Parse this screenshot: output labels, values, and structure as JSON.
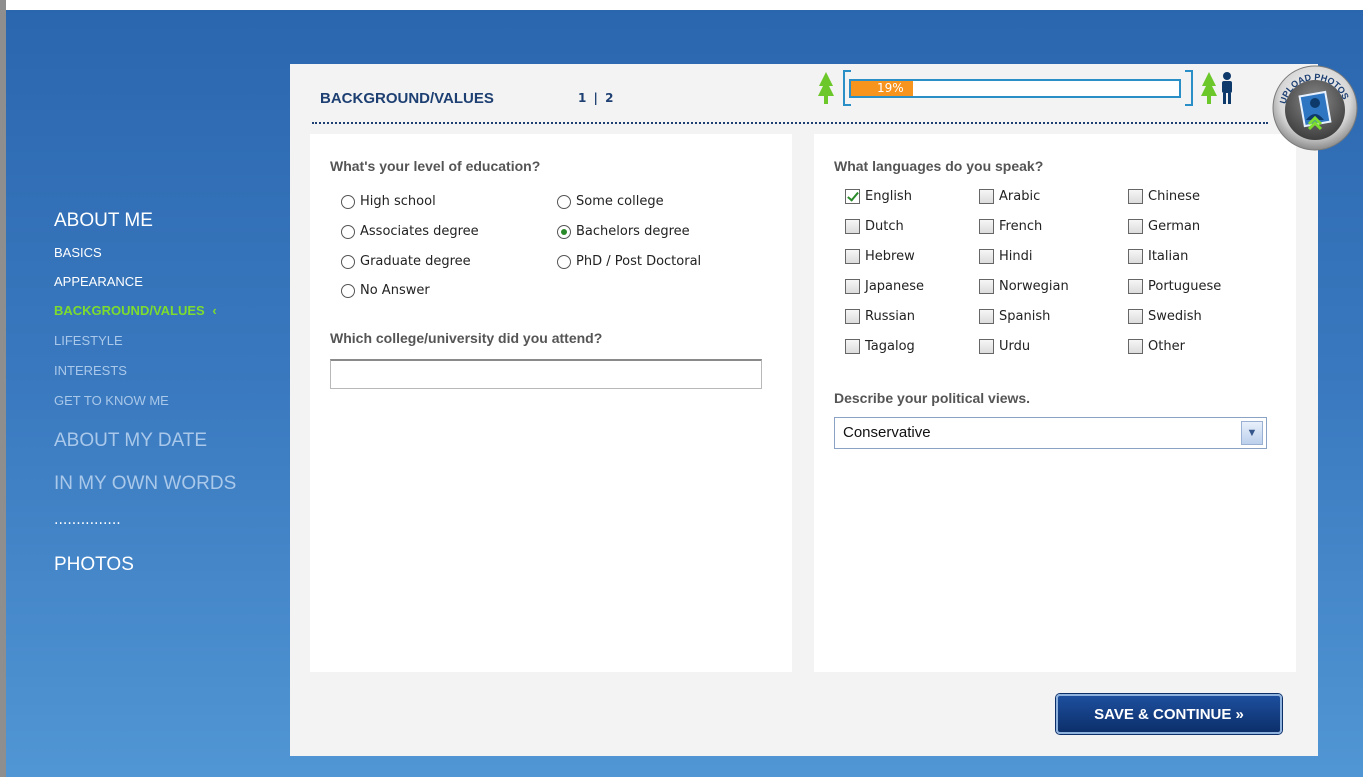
{
  "nav": {
    "about_me": "ABOUT ME",
    "basics": "BASICS",
    "appearance": "APPEARANCE",
    "background_values": "BACKGROUND/VALUES",
    "active_marker": "‹",
    "lifestyle": "LIFESTYLE",
    "interests": "INTERESTS",
    "get_to_know_me": "GET TO KNOW ME",
    "about_my_date": "ABOUT MY DATE",
    "in_my_own_words": "IN MY OWN WORDS",
    "separator": "...............",
    "photos": "PHOTOS"
  },
  "header": {
    "title": "BACKGROUND/VALUES",
    "page_1": "1",
    "page_sep": "|",
    "page_2": "2"
  },
  "progress": {
    "label": "19%",
    "value": 0.19
  },
  "upload": {
    "label": "UPLOAD PHOTOS"
  },
  "education": {
    "question": "What's your level of education?",
    "options": [
      {
        "label": "High school",
        "selected": false
      },
      {
        "label": "Some college",
        "selected": false
      },
      {
        "label": "Associates degree",
        "selected": false
      },
      {
        "label": "Bachelors degree",
        "selected": true
      },
      {
        "label": "Graduate degree",
        "selected": false
      },
      {
        "label": "PhD / Post Doctoral",
        "selected": false
      },
      {
        "label": "No Answer",
        "selected": false
      }
    ]
  },
  "college": {
    "question": "Which college/university did you attend?",
    "value": ""
  },
  "languages": {
    "question": "What languages do you speak?",
    "options": [
      {
        "label": "English",
        "checked": true
      },
      {
        "label": "Arabic",
        "checked": false
      },
      {
        "label": "Chinese",
        "checked": false
      },
      {
        "label": "Dutch",
        "checked": false
      },
      {
        "label": "French",
        "checked": false
      },
      {
        "label": "German",
        "checked": false
      },
      {
        "label": "Hebrew",
        "checked": false
      },
      {
        "label": "Hindi",
        "checked": false
      },
      {
        "label": "Italian",
        "checked": false
      },
      {
        "label": "Japanese",
        "checked": false
      },
      {
        "label": "Norwegian",
        "checked": false
      },
      {
        "label": "Portuguese",
        "checked": false
      },
      {
        "label": "Russian",
        "checked": false
      },
      {
        "label": "Spanish",
        "checked": false
      },
      {
        "label": "Swedish",
        "checked": false
      },
      {
        "label": "Tagalog",
        "checked": false
      },
      {
        "label": "Urdu",
        "checked": false
      },
      {
        "label": "Other",
        "checked": false
      }
    ]
  },
  "political": {
    "question": "Describe your political views.",
    "selected": "Conservative"
  },
  "actions": {
    "save_continue": "SAVE & CONTINUE »"
  },
  "colors": {
    "accent_green": "#7ddc2e",
    "progress_orange": "#f7941d",
    "title_navy": "#1d3f72"
  }
}
